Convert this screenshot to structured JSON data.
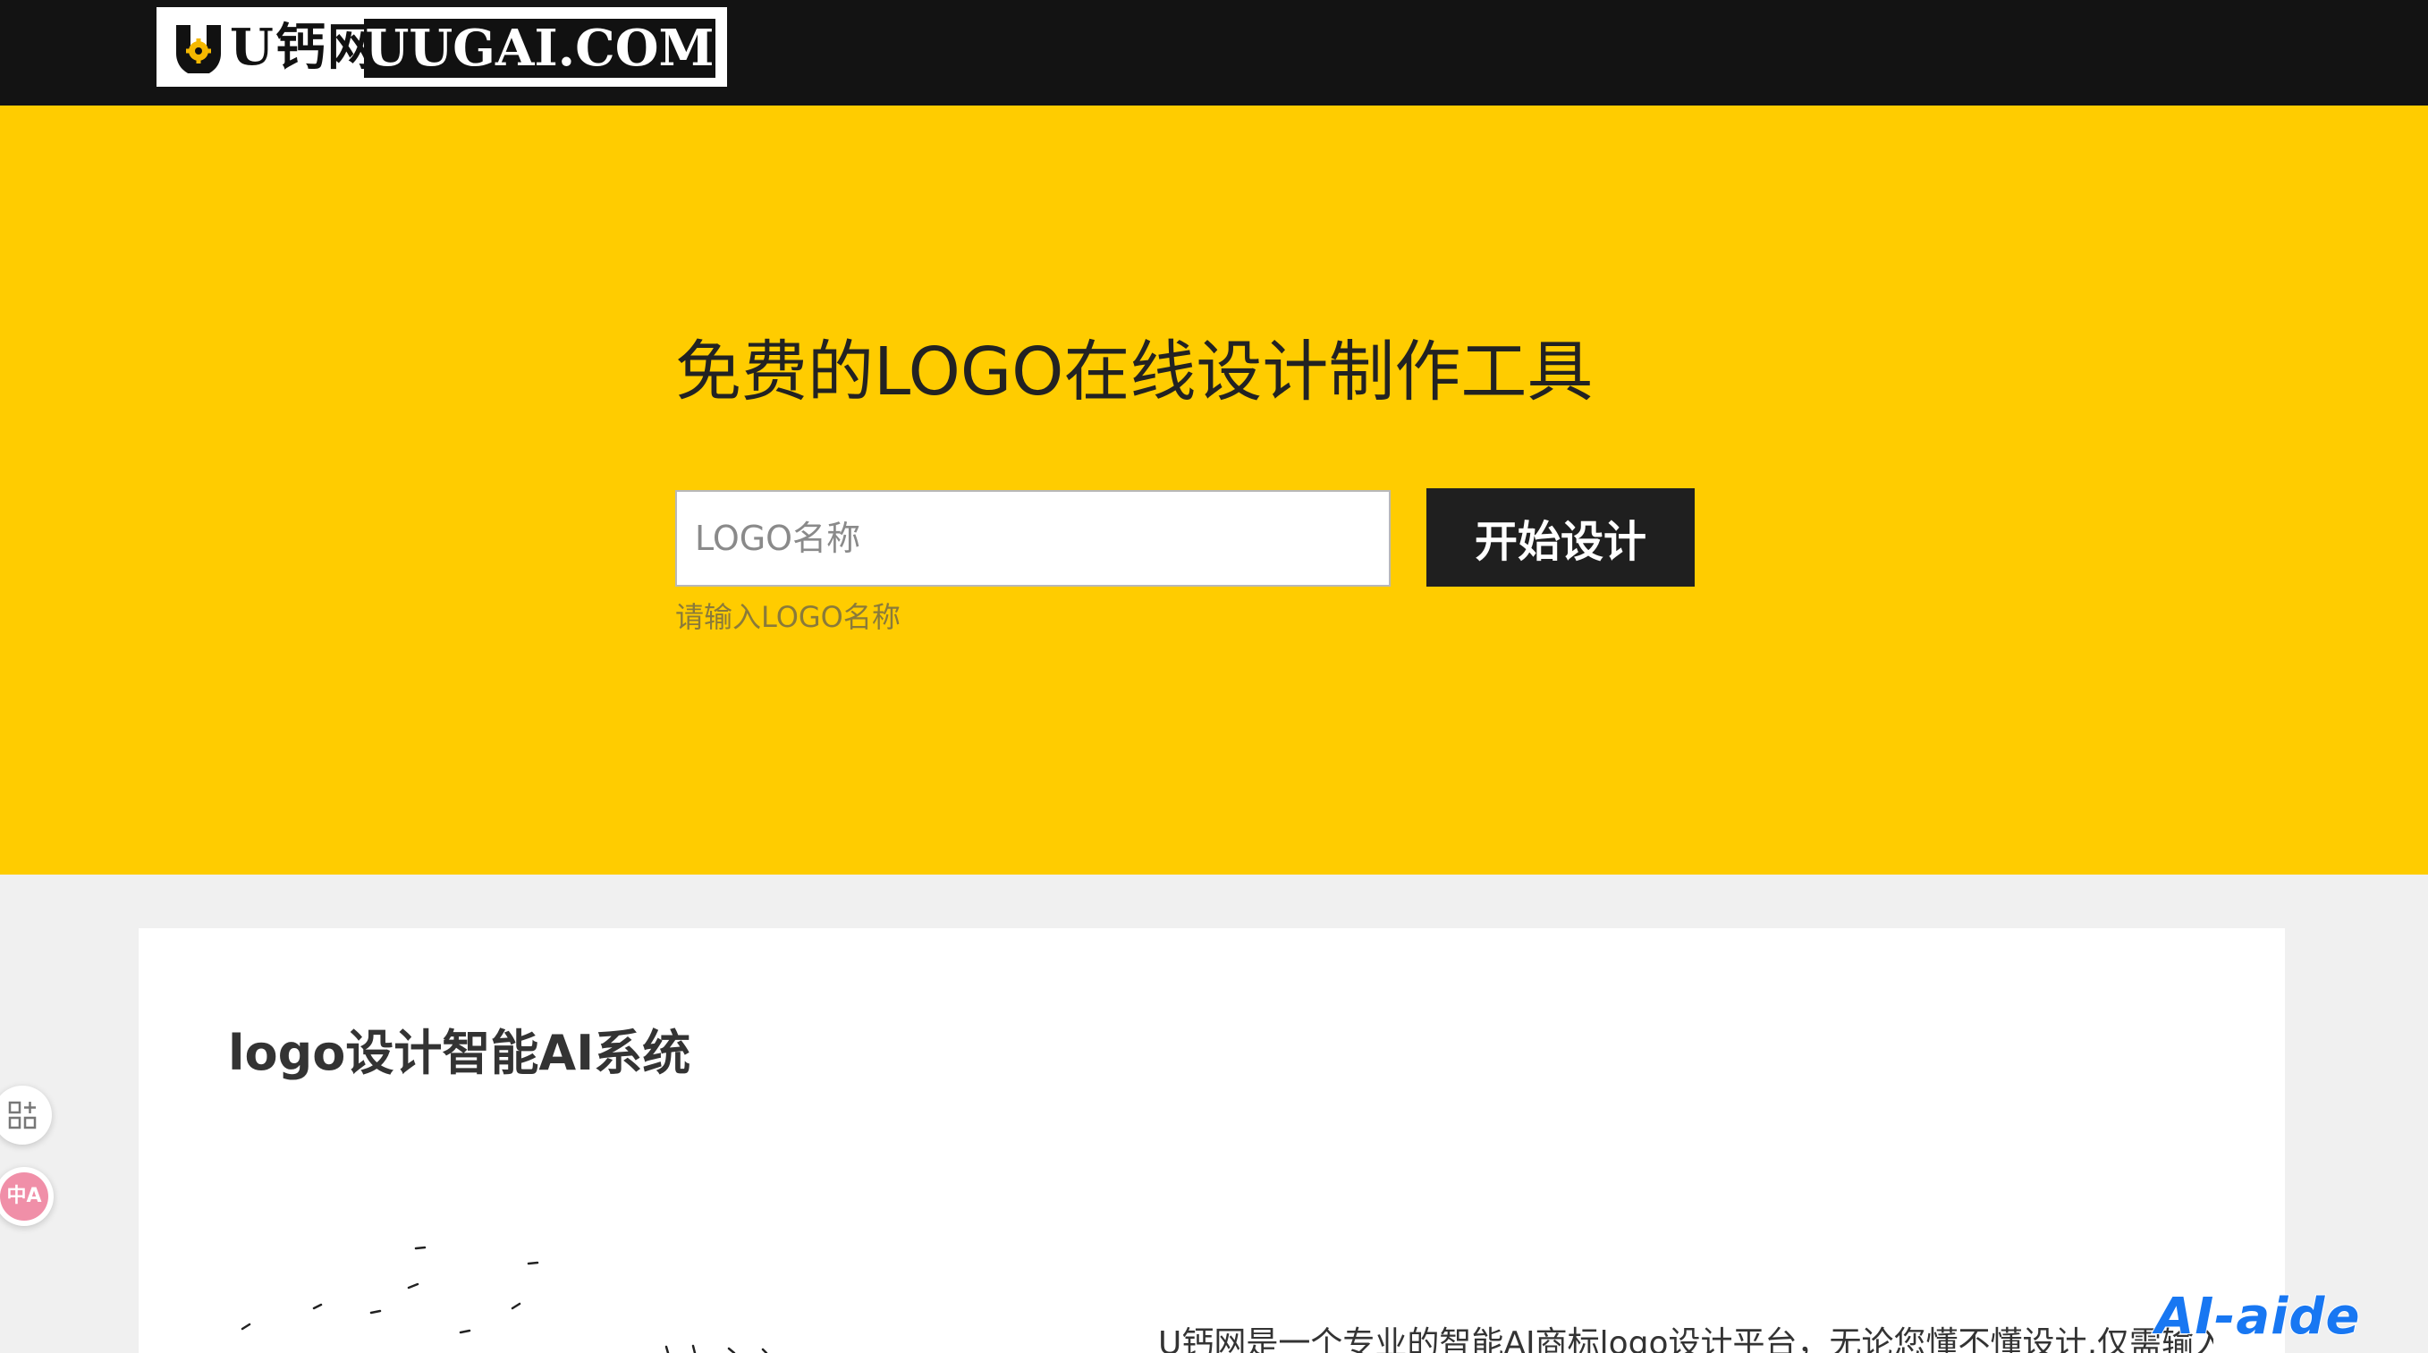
{
  "header": {
    "logo_cn": "U钙网",
    "logo_en": "UUGAI.COM"
  },
  "hero": {
    "title": "免费的LOGO在线设计制作工具",
    "input_placeholder": "LOGO名称",
    "input_value": "",
    "button_label": "开始设计",
    "hint": "请输入LOGO名称",
    "background_color": "#ffcc00"
  },
  "card": {
    "title": "logo设计智能AI系统",
    "description": "U钙网是一个专业的智能AI商标logo设计平台，无论您懂不懂设计,仅需输入文字，您就"
  },
  "floating": {
    "apps_icon": "apps-add-icon",
    "translate_label": "中A"
  },
  "watermark": "AI-aide",
  "colors": {
    "topbar": "#131313",
    "accent": "#ffcc00",
    "button": "#1f1f1f",
    "watermark": "#1877f2"
  }
}
